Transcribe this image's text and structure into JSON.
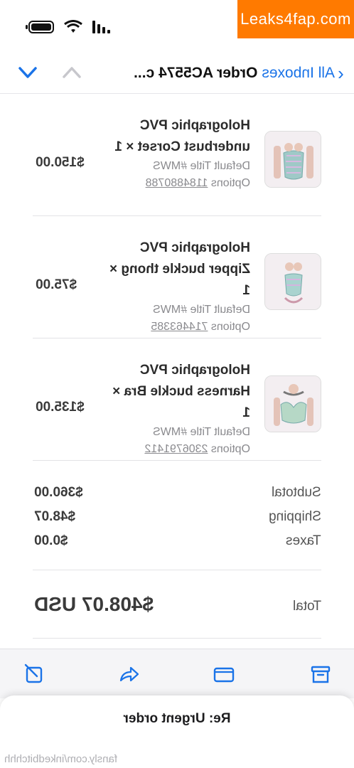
{
  "watermark": "Leaks4fap.com",
  "nav": {
    "back_label": "All Inboxes",
    "subject": "Order AC5574 c..."
  },
  "items": [
    {
      "name": "Holographic PVC underbust Corset × 1",
      "variant": "Default Title #MWS",
      "options_label": "Options",
      "options_num": "1184880788",
      "price": "$150.00"
    },
    {
      "name": "Holographic PVC Zipper buckle thong × 1",
      "variant": "Default Title #MWS",
      "options_label": "Options",
      "options_num": "714463385",
      "price": "$75.00"
    },
    {
      "name": "Holographic PVC Harness buckle Bra × 1",
      "variant": "Default Title #MWS",
      "options_label": "Options",
      "options_num": "2306791412",
      "price": "$135.00"
    }
  ],
  "totals": {
    "subtotal_label": "Subtotal",
    "subtotal": "$360.00",
    "shipping_label": "Shipping",
    "shipping": "$48.07",
    "taxes_label": "Taxes",
    "taxes": "$0.00"
  },
  "grand": {
    "label": "Total",
    "value": "$408.07 USD"
  },
  "reply": {
    "subject": "Re: Urgent order"
  },
  "credit": "fansly.com/inkedbitchhh",
  "colors": {
    "accent": "#1a73e8",
    "watermark_bg": "#ff7a00"
  }
}
